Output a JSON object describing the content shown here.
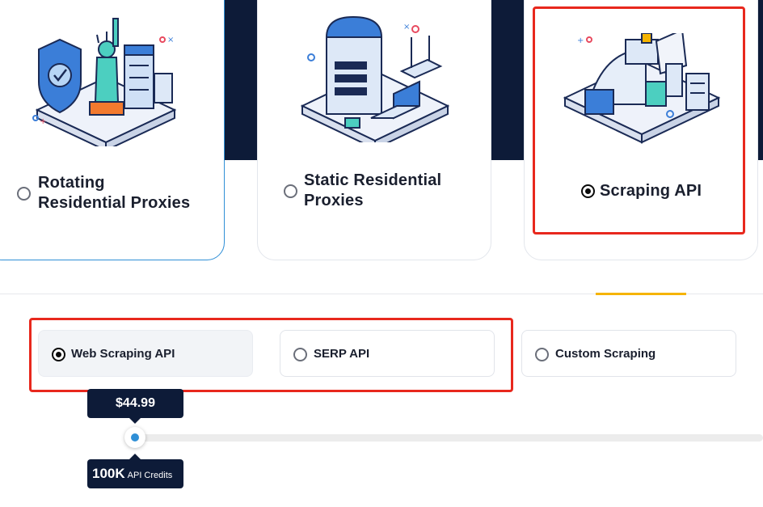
{
  "products": [
    {
      "label_line1": "Rotating",
      "label_line2": "Residential Proxies",
      "selected": false
    },
    {
      "label_line1": "Static Residential",
      "label_line2": "Proxies",
      "selected": false
    },
    {
      "label": "Scraping API",
      "selected": true
    }
  ],
  "sub_products": [
    {
      "label": "Web Scraping API",
      "selected": true
    },
    {
      "label": "SERP API",
      "selected": false
    },
    {
      "label": "Custom Scraping",
      "selected": false
    }
  ],
  "slider": {
    "price": "$44.99",
    "credits_value": "100K",
    "credits_unit": "API Credits",
    "position_fraction": 0
  },
  "colors": {
    "navy": "#0d1b38",
    "accent_blue": "#2f8fd6",
    "highlight_red": "#e8281d",
    "tab_yellow": "#f5b400"
  },
  "icons": [
    "shield-icon",
    "statue-of-liberty-icon",
    "server-rack-icon",
    "router-icon",
    "laptop-icon",
    "factory-icon"
  ]
}
